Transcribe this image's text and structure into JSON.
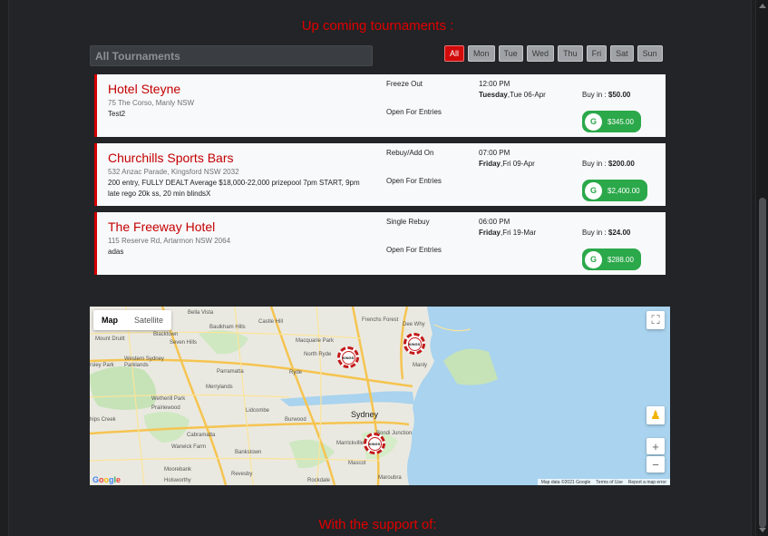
{
  "headings": {
    "upcoming": "Up coming tournaments :",
    "support": "With the support of:"
  },
  "search": {
    "placeholder": "All Tournaments"
  },
  "day_filters": [
    "All",
    "Mon",
    "Tue",
    "Wed",
    "Thu",
    "Fri",
    "Sat",
    "Sun"
  ],
  "active_day": "All",
  "tournaments": [
    {
      "name": "Hotel Steyne",
      "address": "75 The Corso, Manly NSW",
      "description": "Test2",
      "type": "Freeze Out",
      "status": "Open For Entries",
      "time": "12:00 PM",
      "day": "Tuesday",
      "date": ",Tue 06-Apr",
      "buyin_label": "Buy in : ",
      "buyin": "$50.00",
      "prize_icon": "G",
      "prize": "$345.00"
    },
    {
      "name": "Churchills Sports Bars",
      "address": "532 Anzac Parade, Kingsford NSW 2032",
      "description": "200 entry, FULLY DEALT Average $18,000-22,000 prizepool 7pm START, 9pm late rego 20k ss, 20 min blindsX",
      "type": "Rebuy/Add On",
      "status": "Open For Entries",
      "time": "07:00 PM",
      "day": "Friday",
      "date": ",Fri 09-Apr",
      "buyin_label": "Buy in : ",
      "buyin": "$200.00",
      "prize_icon": "G",
      "prize": "$2,400.00"
    },
    {
      "name": "The Freeway Hotel",
      "address": "115 Reserve Rd, Artarmon NSW 2064",
      "description": "adas",
      "type": "Single Rebuy",
      "status": "Open For Entries",
      "time": "06:00 PM",
      "day": "Friday",
      "date": ",Fri 19-Mar",
      "buyin_label": "Buy in : ",
      "buyin": "$24.00",
      "prize_icon": "G",
      "prize": "$288.00"
    }
  ],
  "map": {
    "type_map": "Map",
    "type_satellite": "Satellite",
    "google": "Google",
    "footer_data": "Map data ©2021 Google",
    "footer_terms": "Terms of Use",
    "footer_report": "Report a map error",
    "marker_text": "KINGS",
    "labels": {
      "castle_hill": "Castle Hill",
      "bella_vista": "Bella Vista",
      "baulkham_hills": "Baulkham Hills",
      "frenchs_forest": "Frenchs Forest",
      "dee_why": "Dee Why",
      "blacktown": "Blacktown",
      "seven_hills": "Seven Hills",
      "mount_druitt": "Mount Druitt",
      "macquarie_park": "Macquarie Park",
      "north_ryde": "North Ryde",
      "western_sydney_parklands": "Western Sydney Parklands",
      "parramatta": "Parramatta",
      "ryde": "Ryde",
      "manly": "Manly",
      "merrylands": "Merrylands",
      "wetherill_park": "Wetherill Park",
      "prairiewood": "Prairiewood",
      "lidcombe": "Lidcombe",
      "burwood": "Burwood",
      "sydney": "Sydney",
      "cabramatta": "Cabramatta",
      "warwick_farm": "Warwick Farm",
      "bankstown": "Bankstown",
      "marrickville": "Marrickville",
      "bondi_junction": "Bondi Junction",
      "moorebank": "Moorebank",
      "revesby": "Revesby",
      "mascot": "Mascot",
      "maroubra": "Maroubra",
      "holsworthy": "Holsworthy",
      "rockdale": "Rockdale",
      "horsley_park": "rsley Park",
      "hips_creek": "hips Creek"
    }
  }
}
